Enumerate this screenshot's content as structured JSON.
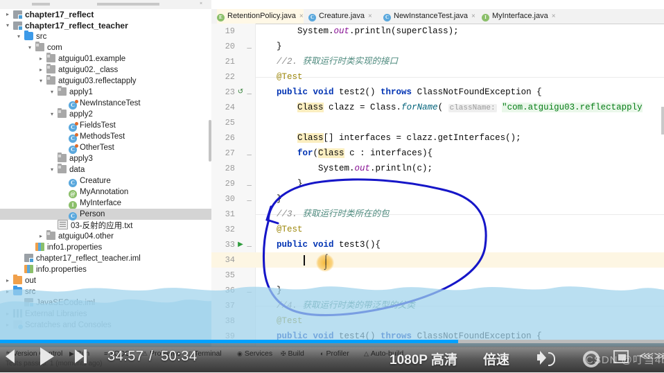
{
  "window": {
    "app": "IntelliJ IDEA",
    "context": "screen-recording video player"
  },
  "top_tab_strip": {
    "partial_tabs": [
      "",
      "",
      "",
      "",
      "",
      "",
      ""
    ]
  },
  "sidebar": {
    "scrollbar": "vertical-scrollbar",
    "items": [
      {
        "label": "chapter17_reflect",
        "indent": 0,
        "arrow": ">",
        "icon": "module-icon",
        "bold": true,
        "selected": false
      },
      {
        "label": "chapter17_reflect_teacher",
        "indent": 0,
        "arrow": "v",
        "icon": "module-icon",
        "bold": true,
        "selected": false
      },
      {
        "label": "src",
        "indent": 1,
        "arrow": "v",
        "icon": "source-folder-icon",
        "bold": false,
        "selected": false
      },
      {
        "label": "com",
        "indent": 2,
        "arrow": "v",
        "icon": "package-icon",
        "bold": false,
        "selected": false
      },
      {
        "label": "atguigu01.example",
        "indent": 3,
        "arrow": ">",
        "icon": "package-icon",
        "bold": false,
        "selected": false
      },
      {
        "label": "atguigu02._class",
        "indent": 3,
        "arrow": ">",
        "icon": "package-icon",
        "bold": false,
        "selected": false
      },
      {
        "label": "atguigu03.reflectapply",
        "indent": 3,
        "arrow": "v",
        "icon": "package-icon",
        "bold": false,
        "selected": false
      },
      {
        "label": "apply1",
        "indent": 4,
        "arrow": "v",
        "icon": "package-icon",
        "bold": false,
        "selected": false
      },
      {
        "label": "NewInstanceTest",
        "indent": 5,
        "arrow": "",
        "icon": "class-test-icon",
        "bold": false,
        "selected": false
      },
      {
        "label": "apply2",
        "indent": 4,
        "arrow": "v",
        "icon": "package-icon",
        "bold": false,
        "selected": false
      },
      {
        "label": "FieldsTest",
        "indent": 5,
        "arrow": "",
        "icon": "class-test-icon",
        "bold": false,
        "selected": false
      },
      {
        "label": "MethodsTest",
        "indent": 5,
        "arrow": "",
        "icon": "class-test-icon",
        "bold": false,
        "selected": false
      },
      {
        "label": "OtherTest",
        "indent": 5,
        "arrow": "",
        "icon": "class-test-icon",
        "bold": false,
        "selected": false
      },
      {
        "label": "apply3",
        "indent": 4,
        "arrow": "",
        "icon": "package-icon",
        "bold": false,
        "selected": false
      },
      {
        "label": "data",
        "indent": 4,
        "arrow": "v",
        "icon": "package-icon",
        "bold": false,
        "selected": false
      },
      {
        "label": "Creature",
        "indent": 5,
        "arrow": "",
        "icon": "class-icon",
        "bold": false,
        "selected": false
      },
      {
        "label": "MyAnnotation",
        "indent": 5,
        "arrow": "",
        "icon": "annotation-icon",
        "bold": false,
        "selected": false
      },
      {
        "label": "MyInterface",
        "indent": 5,
        "arrow": "",
        "icon": "interface-icon",
        "bold": false,
        "selected": false
      },
      {
        "label": "Person",
        "indent": 5,
        "arrow": "",
        "icon": "class-icon",
        "bold": false,
        "selected": true
      },
      {
        "label": "03-反射的应用.txt",
        "indent": 4,
        "arrow": "",
        "icon": "text-file-icon",
        "bold": false,
        "selected": false
      },
      {
        "label": "atguigu04.other",
        "indent": 3,
        "arrow": ">",
        "icon": "package-icon",
        "bold": false,
        "selected": false
      },
      {
        "label": "info1.properties",
        "indent": 2,
        "arrow": "",
        "icon": "properties-icon",
        "bold": false,
        "selected": false
      },
      {
        "label": "chapter17_reflect_teacher.iml",
        "indent": 1,
        "arrow": "",
        "icon": "iml-icon",
        "bold": false,
        "selected": false
      },
      {
        "label": "info.properties",
        "indent": 1,
        "arrow": "",
        "icon": "properties-icon",
        "bold": false,
        "selected": false
      },
      {
        "label": "out",
        "indent": 0,
        "arrow": ">",
        "icon": "out-folder-icon",
        "bold": false,
        "selected": false
      },
      {
        "label": "src",
        "indent": 0,
        "arrow": ">",
        "icon": "source-folder-icon",
        "bold": false,
        "selected": false
      },
      {
        "label": "JavaSECode.iml",
        "indent": 1,
        "arrow": "",
        "icon": "iml-icon",
        "bold": false,
        "selected": false
      },
      {
        "label": "External Libraries",
        "indent": 0,
        "arrow": ">",
        "icon": "libraries-icon",
        "bold": false,
        "selected": false
      },
      {
        "label": "Scratches and Consoles",
        "indent": 0,
        "arrow": ">",
        "icon": "scratches-icon",
        "bold": false,
        "selected": false
      }
    ]
  },
  "editor": {
    "tabs": [
      {
        "label": "RetentionPolicy.java",
        "icon_letter": "E",
        "icon_color": "#8bbf6a",
        "active": true,
        "close": "×"
      },
      {
        "label": "Creature.java",
        "icon_letter": "C",
        "icon_color": "#5aa8dd",
        "active": false,
        "close": "×"
      },
      {
        "label": "NewInstanceTest.java",
        "icon_letter": "C",
        "icon_color": "#5aa8dd",
        "active": false,
        "close": "×"
      },
      {
        "label": "MyInterface.java",
        "icon_letter": "I",
        "icon_color": "#8bbf6a",
        "active": false,
        "close": "×"
      }
    ],
    "first_line_number": 19,
    "highlighted_line": 34,
    "lines": [
      {
        "n": 19,
        "text": "        System.out.println(superClass);"
      },
      {
        "n": 20,
        "text": "    }"
      },
      {
        "n": 21,
        "text": "    //2. 获取运行时类实现的接口"
      },
      {
        "n": 22,
        "text": "    @Test"
      },
      {
        "n": 23,
        "text": "    public void test2() throws ClassNotFoundException {"
      },
      {
        "n": 24,
        "text": "        Class clazz = Class.forName( className: \"com.atguigu03.reflectapply"
      },
      {
        "n": 25,
        "text": ""
      },
      {
        "n": 26,
        "text": "        Class[] interfaces = clazz.getInterfaces();"
      },
      {
        "n": 27,
        "text": "        for(Class c : interfaces){"
      },
      {
        "n": 28,
        "text": "            System.out.println(c);"
      },
      {
        "n": 29,
        "text": "        }"
      },
      {
        "n": 30,
        "text": "    }"
      },
      {
        "n": 31,
        "text": "    //3. 获取运行时类所在的包"
      },
      {
        "n": 32,
        "text": "    @Test"
      },
      {
        "n": 33,
        "text": "    public void test3(){"
      },
      {
        "n": 34,
        "text": "        "
      },
      {
        "n": 35,
        "text": ""
      },
      {
        "n": 36,
        "text": "    }"
      },
      {
        "n": 37,
        "text": "    //4. 获取运行时类的带泛型的父类"
      },
      {
        "n": 38,
        "text": "    @Test"
      },
      {
        "n": 39,
        "text": "    public void test4() throws ClassNotFoundException {"
      }
    ],
    "gutter_markers": [
      {
        "line": 23,
        "marker": "test-run-green-icon"
      },
      {
        "line": 33,
        "marker": "run-play-green-icon"
      },
      {
        "line": 39,
        "marker": "test-run-green-icon"
      }
    ],
    "annotation": "blue-hand-drawn-circle"
  },
  "ide_bottom_bar": {
    "items": [
      {
        "label": "Version Control",
        "icon": "branch-icon"
      },
      {
        "label": "Run",
        "icon": "play-icon"
      },
      {
        "label": "TODO",
        "icon": "list-icon"
      },
      {
        "label": "Problems",
        "icon": "warning-icon"
      },
      {
        "label": "Terminal",
        "icon": "terminal-icon"
      },
      {
        "label": "Services",
        "icon": "services-icon"
      },
      {
        "label": "Build",
        "icon": "hammer-icon"
      },
      {
        "label": "Profiler",
        "icon": "profiler-icon"
      },
      {
        "label": "Auto-build",
        "icon": "auto-build-icon"
      }
    ],
    "status_message": "Tests passed: 1 (moments ago)"
  },
  "video_player": {
    "prev_label": "previous-video",
    "play_label": "play",
    "next_label": "next-video",
    "current_time": "34:57",
    "separator": "/",
    "total_time": "50:34",
    "quality": "1080P 高清",
    "speed": "倍速",
    "volume_label": "volume",
    "settings_label": "settings",
    "picture_in_picture_label": "picture-in-picture",
    "fullscreen_label": "fullscreen",
    "progress_percent": 69,
    "watermark": "CSDN @叮当4b"
  },
  "colors": {
    "accent": "#00a1ff",
    "annotation": "#1616c8",
    "selection": "#d4d4d4",
    "highlight_line": "#fdf6e3",
    "water_overlay": "#a9d6ec"
  }
}
